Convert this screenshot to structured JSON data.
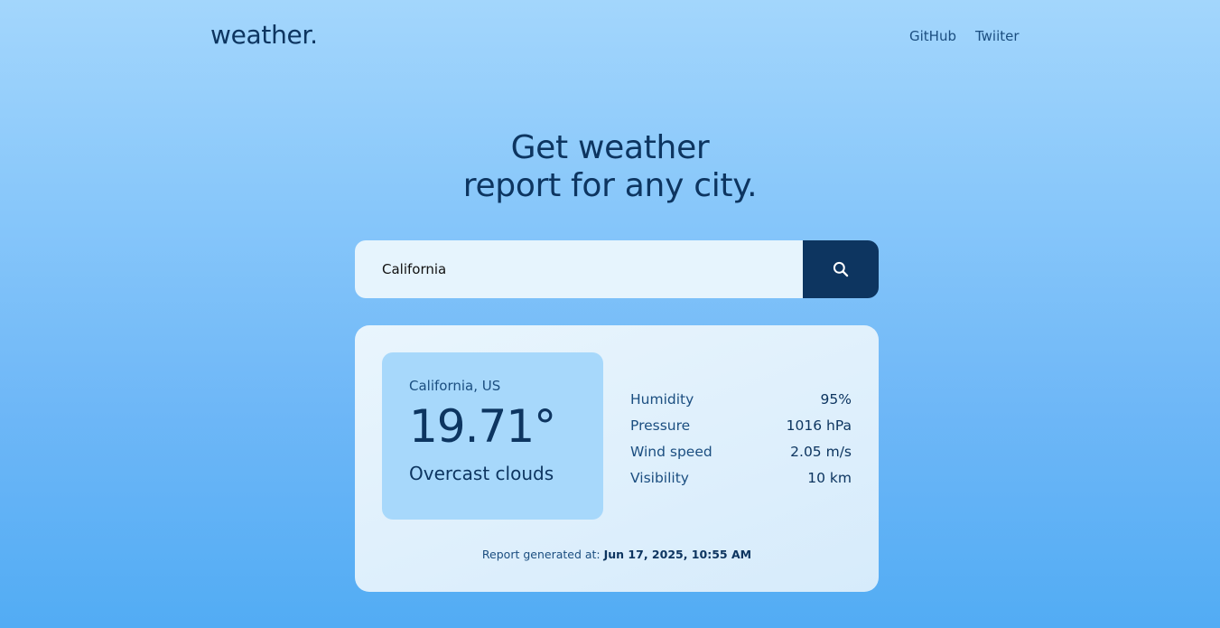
{
  "header": {
    "logo": "weather.",
    "nav": [
      {
        "label": "GitHub"
      },
      {
        "label": "Twiiter"
      }
    ]
  },
  "hero": {
    "line1": "Get weather",
    "line2": "report for any city."
  },
  "search": {
    "value": "California",
    "icon": "search-icon"
  },
  "report": {
    "location": "California, US",
    "temperature": "19.71°",
    "description": "Overcast clouds",
    "stats": [
      {
        "label": "Humidity",
        "value": "95%"
      },
      {
        "label": "Pressure",
        "value": "1016 hPa"
      },
      {
        "label": "Wind speed",
        "value": "2.05 m/s"
      },
      {
        "label": "Visibility",
        "value": "10 km"
      }
    ],
    "generated_label": "Report generated at: ",
    "generated_time": "Jun 17, 2025, 10:55 AM"
  },
  "colors": {
    "primary": "#0d3560",
    "card": "#e6f4fd",
    "highlight_box": "#a7d8fb"
  }
}
